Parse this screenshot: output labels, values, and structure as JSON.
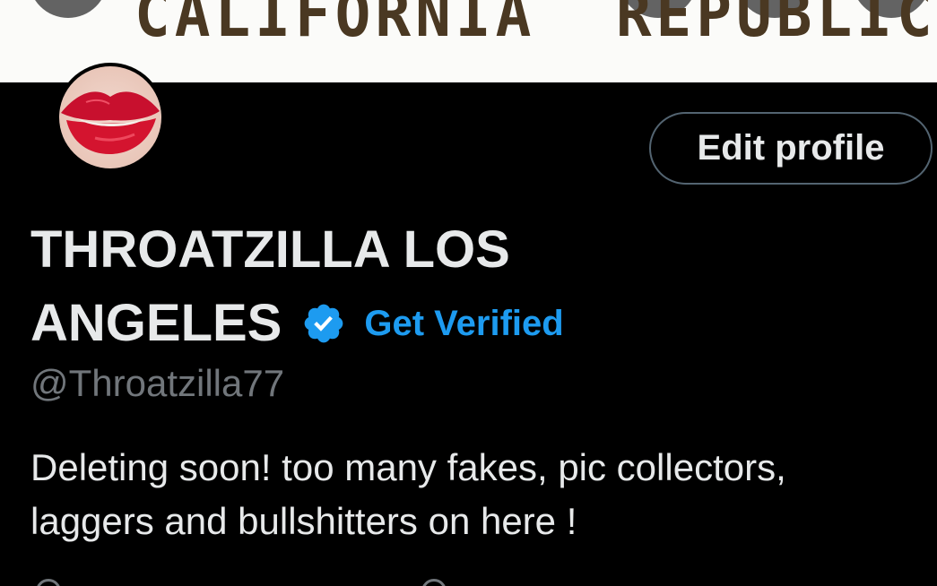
{
  "banner": {
    "text": "CALIFORNIA  REPUBLIC"
  },
  "profile": {
    "edit_button_label": "Edit profile",
    "display_name_line1": "THROATZILLA LOS",
    "display_name_line2": "ANGELES",
    "verified_icon": "verified-badge-icon",
    "get_verified_label": "Get Verified",
    "handle": "@Throatzilla77",
    "bio": "Deleting soon! too many fakes, pic collectors, laggers and bullshitters on here !"
  },
  "colors": {
    "background": "#000000",
    "text": "#e7e9ea",
    "secondary_text": "#71767b",
    "accent": "#1d9bf0",
    "button_border": "#536471",
    "banner_text": "#4a3822"
  }
}
